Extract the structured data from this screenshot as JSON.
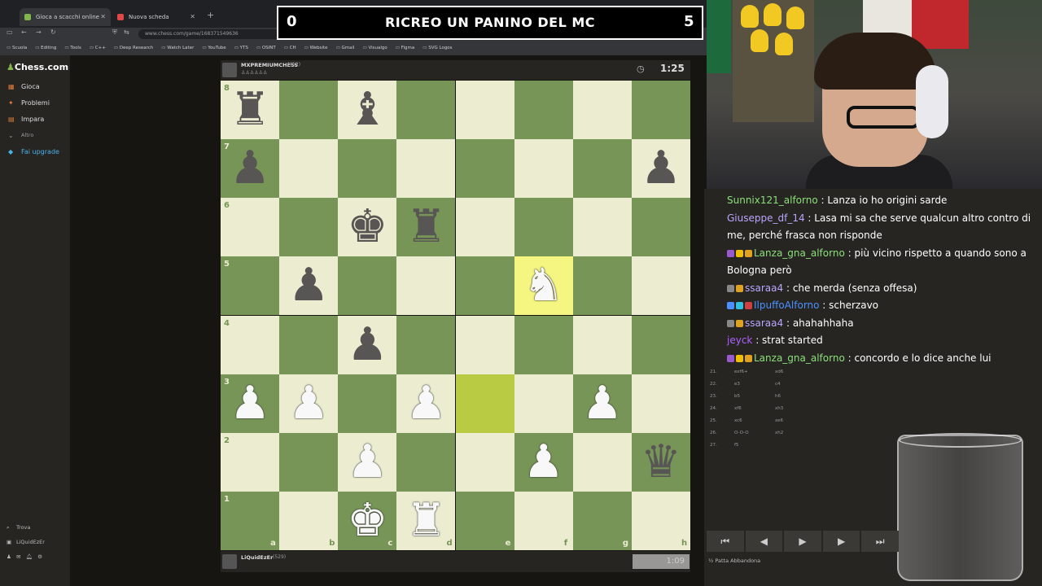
{
  "browser": {
    "tabs": [
      {
        "label": "Gioca a scacchi online GRATIS",
        "active": true,
        "color": "#81b64c"
      },
      {
        "label": "Nuova scheda",
        "active": false,
        "color": "#e04848"
      }
    ],
    "url": "www.chess.com/game/168371549636",
    "bookmarks": [
      "Scuola",
      "Editing",
      "Tools",
      "C++",
      "Deep Research",
      "Watch Later",
      "YouTube",
      "YTS",
      "OSINT",
      "CH",
      "Website",
      "Gmail",
      "Visualgo",
      "Figma",
      "SVG Logos"
    ]
  },
  "sidebar": {
    "logo": "Chess.com",
    "items": [
      {
        "label": "Gioca",
        "icon": "board-icon",
        "color": "#e07b3a"
      },
      {
        "label": "Problemi",
        "icon": "puzzle-icon",
        "color": "#e07b3a"
      },
      {
        "label": "Impara",
        "icon": "book-icon",
        "color": "#e07b3a"
      },
      {
        "label": "Altro",
        "icon": "chevron-down-icon",
        "color": "#999999"
      },
      {
        "label": "Fai upgrade",
        "icon": "diamond-icon",
        "color": "#4ab2e8"
      }
    ],
    "bottom": [
      {
        "label": "Trova",
        "icon": "search-icon"
      },
      {
        "label": "LiQuidEzEr",
        "icon": "avatar-icon"
      }
    ]
  },
  "banner": {
    "score_left": "0",
    "title": "RICREO UN PANINO DEL MC",
    "score_right": "5"
  },
  "game": {
    "opponent": {
      "name": "MXPREMIUMCHESS",
      "rating": "(452)",
      "clock": "1:25"
    },
    "player": {
      "name": "LiQuidEzEr",
      "rating": "(529)",
      "clock": "1:09"
    },
    "files": [
      "a",
      "b",
      "c",
      "d",
      "e",
      "f",
      "g",
      "h"
    ],
    "ranks": [
      "8",
      "7",
      "6",
      "5",
      "4",
      "3",
      "2",
      "1"
    ],
    "highlights": [
      "f5",
      "e3"
    ],
    "pieces": [
      {
        "sq": "a8",
        "piece": "♜",
        "color": "b"
      },
      {
        "sq": "c8",
        "piece": "♝",
        "color": "b"
      },
      {
        "sq": "a7",
        "piece": "♟",
        "color": "b"
      },
      {
        "sq": "h7",
        "piece": "♟",
        "color": "b"
      },
      {
        "sq": "c6",
        "piece": "♚",
        "color": "b"
      },
      {
        "sq": "d6",
        "piece": "♜",
        "color": "b"
      },
      {
        "sq": "b5",
        "piece": "♟",
        "color": "b"
      },
      {
        "sq": "f5",
        "piece": "♞",
        "color": "w"
      },
      {
        "sq": "c4",
        "piece": "♟",
        "color": "b"
      },
      {
        "sq": "a3",
        "piece": "♟",
        "color": "w"
      },
      {
        "sq": "b3",
        "piece": "♟",
        "color": "w"
      },
      {
        "sq": "d3",
        "piece": "♟",
        "color": "w"
      },
      {
        "sq": "g3",
        "piece": "♟",
        "color": "w"
      },
      {
        "sq": "c2",
        "piece": "♟",
        "color": "w"
      },
      {
        "sq": "f2",
        "piece": "♟",
        "color": "w"
      },
      {
        "sq": "h2",
        "piece": "♛",
        "color": "b"
      },
      {
        "sq": "c1",
        "piece": "♚",
        "color": "w"
      },
      {
        "sq": "d1",
        "piece": "♜",
        "color": "w"
      }
    ]
  },
  "chat": [
    {
      "user": "Sunnix121_alforno",
      "color": "#8be07a",
      "msg": "Lanza io ho origini sarde",
      "badges": []
    },
    {
      "user": "Giuseppe_df_14",
      "color": "#b9a6ff",
      "msg": "Lasa mi sa che serve qualcun altro contro di me, perché frasca non risponde",
      "badges": []
    },
    {
      "user": "Lanza_gna_alforno",
      "color": "#8be07a",
      "msg": "più vicino rispetto a quando sono a Bologna però",
      "badges": [
        "#9b59d0",
        "#f0c000",
        "#e0a020"
      ]
    },
    {
      "user": "ssaraa4",
      "color": "#b9a6ff",
      "msg": "che merda (senza offesa)",
      "badges": [
        "#888888",
        "#e0a020"
      ]
    },
    {
      "user": "IlpuffoAlforno",
      "color": "#4a90ff",
      "msg": "scherzavo",
      "badges": [
        "#4a90ff",
        "#30c0e0",
        "#d04040"
      ]
    },
    {
      "user": "ssaraa4",
      "color": "#b9a6ff",
      "msg": "ahahahhaha",
      "badges": [
        "#888888",
        "#e0a020"
      ]
    },
    {
      "user": "jeyck",
      "color": "#b060ff",
      "msg": "strat started",
      "badges": []
    },
    {
      "user": "Lanza_gna_alforno",
      "color": "#8be07a",
      "msg": "concordo e lo dice anche lui",
      "badges": [
        "#9b59d0",
        "#f0c000",
        "#e0a020"
      ]
    }
  ],
  "moves_visible": [
    {
      "n": "21.",
      "w": "exf6+",
      "b": "xd6"
    },
    {
      "n": "22.",
      "w": "e3",
      "b": "c4"
    },
    {
      "n": "23.",
      "w": "b5",
      "b": "h6"
    },
    {
      "n": "24.",
      "w": "xf6",
      "b": "xh3"
    },
    {
      "n": "25.",
      "w": "xc6",
      "b": "xe6"
    },
    {
      "n": "26.",
      "w": "O-O-O",
      "b": "xh2"
    },
    {
      "n": "27.",
      "w": "f5",
      "b": ""
    }
  ],
  "controls": {
    "buttons": [
      "⏮",
      "◀",
      "▶",
      "▶",
      "⏭"
    ],
    "footer": "Patta   Abbandona"
  }
}
